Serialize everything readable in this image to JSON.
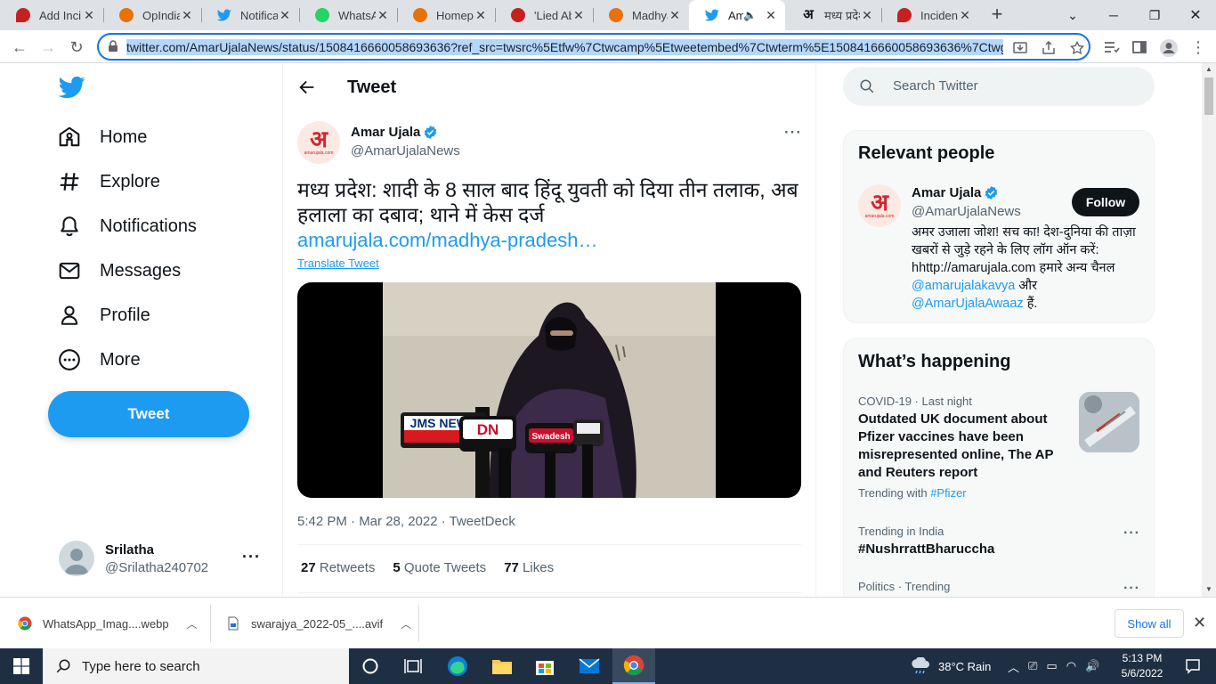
{
  "browser": {
    "tabs": [
      {
        "label": "Add Inci",
        "icon": "red-drop-icon",
        "color": "#c5221f"
      },
      {
        "label": "OpIndia",
        "icon": "opindia-icon",
        "color": "#e8710a"
      },
      {
        "label": "Notificat",
        "icon": "twitter-icon",
        "color": "#1d9bf0"
      },
      {
        "label": "WhatsAp",
        "icon": "whatsapp-icon",
        "color": "#25d366"
      },
      {
        "label": "Homepa",
        "icon": "opindia-icon",
        "color": "#e8710a"
      },
      {
        "label": "'Lied Ab",
        "icon": "swarajya-icon",
        "color": "#c5221f"
      },
      {
        "label": "Madhya",
        "icon": "opindia-icon",
        "color": "#e8710a"
      },
      {
        "label": "Ama",
        "icon": "twitter-icon",
        "color": "#1d9bf0"
      },
      {
        "label": "मध्य प्रदेश",
        "icon": "amarujala-icon",
        "color": "#d0262f"
      },
      {
        "label": "Incident",
        "icon": "red-drop-icon",
        "color": "#c5221f"
      }
    ],
    "active_tab": 7,
    "url": "twitter.com/AmarUjalaNews/status/1508416660058693636?ref_src=twsrc%5Etfw%7Ctwcamp%5Etweetembed%7Ctwterm%5E1508416660058693636%7Ctwgr%"
  },
  "twitter": {
    "nav": {
      "home": "Home",
      "explore": "Explore",
      "notifications": "Notifications",
      "messages": "Messages",
      "profile": "Profile",
      "more": "More",
      "tweet_button": "Tweet"
    },
    "account": {
      "name": "Srilatha",
      "handle": "@Srilatha240702"
    },
    "main": {
      "header": "Tweet",
      "author_name": "Amar Ujala",
      "author_handle": "@AmarUjalaNews",
      "avatar_glyph": "अ",
      "avatar_sub": "amarujala.com",
      "text": "मध्य प्रदेश: शादी के 8 साल बाद हिंदू युवती को दिया तीन तलाक, अब हलाला का दबाव; थाने में केस दर्ज",
      "link": "amarujala.com/madhya-pradesh…",
      "translate": "Translate Tweet",
      "timestamp": "5:42 PM · Mar 28, 2022 · TweetDeck",
      "retweets": "27",
      "retweets_label": "Retweets",
      "quotes": "5",
      "quotes_label": "Quote Tweets",
      "likes": "77",
      "likes_label": "Likes",
      "mic_labels": [
        "JMS NEWS",
        "DN",
        "Swadesh"
      ]
    },
    "search_placeholder": "Search Twitter",
    "relevant": {
      "title": "Relevant people",
      "name": "Amar Ujala",
      "handle": "@AmarUjalaNews",
      "follow": "Follow",
      "bio_text": "अमर उजाला जोश! सच का! देश-दुनिया की ताज़ा खबरों से जुड़े रहने के लिए लॉग ऑन करें: hhttp://amarujala.com हमारे अन्य चैनल ",
      "bio_mention1": "@amarujalakavya",
      "bio_and": " और ",
      "bio_mention2": "@AmarUjalaAwaaz",
      "bio_end": " हैं."
    },
    "happening": {
      "title": "What’s happening",
      "t1_meta": "COVID-19 · Last night",
      "t1_title": "Outdated UK document about Pfizer vaccines have been misrepresented online, The AP and Reuters report",
      "t1_with": "Trending with ",
      "t1_tag": "#Pfizer",
      "t2_meta": "Trending in India",
      "t2_title": "#NushrrattBharuccha",
      "t3_meta": "Politics · Trending"
    }
  },
  "downloads": {
    "item1": "WhatsApp_Imag....webp",
    "item2": "swarajya_2022-05_....avif",
    "show_all": "Show all"
  },
  "taskbar": {
    "search_placeholder": "Type here to search",
    "weather": "38°C  Rain",
    "time": "5:13 PM",
    "date": "5/6/2022"
  },
  "colors": {
    "twitter_blue": "#1d9bf0",
    "taskbar": "#1f2f43",
    "selection": "#b4d7fe"
  }
}
